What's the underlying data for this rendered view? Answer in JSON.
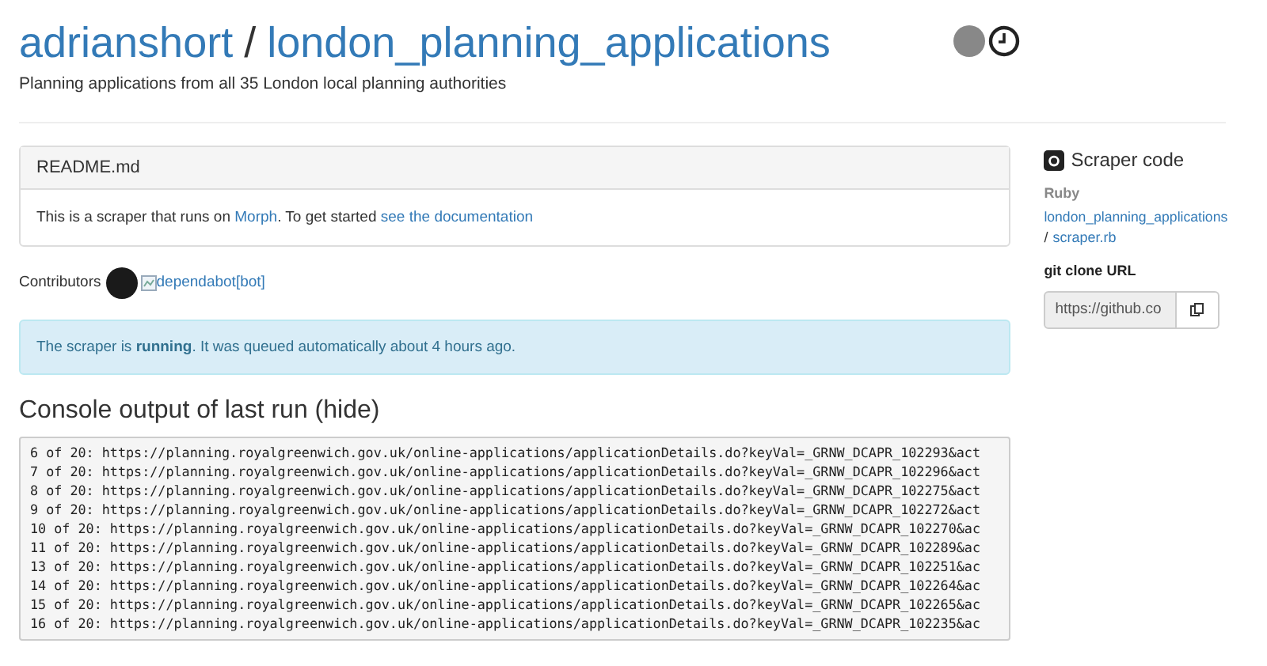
{
  "header": {
    "owner": "adrianshort",
    "separator": "/",
    "repo": "london_planning_applications",
    "description": "Planning applications from all 35 London local planning authorities"
  },
  "readme": {
    "title": "README.md",
    "text_before": "This is a scraper that runs on ",
    "link_1": "Morph",
    "text_mid": ". To get started ",
    "link_2": "see the documentation"
  },
  "contributors": {
    "label": "Contributors",
    "items": [
      {
        "kind": "avatar"
      },
      {
        "kind": "broken_image",
        "alt": "dependabot[bot]"
      }
    ]
  },
  "status": {
    "message": "The scraper is **running**. It was queued automatically about 4 hours ago."
  },
  "console": {
    "title": "Console output of last run (hide)",
    "lines": [
      "6 of 20: https://planning.royalgreenwich.gov.uk/online-applications/applicationDetails.do?keyVal=_GRNW_DCAPR_102293&act",
      "7 of 20: https://planning.royalgreenwich.gov.uk/online-applications/applicationDetails.do?keyVal=_GRNW_DCAPR_102296&act",
      "8 of 20: https://planning.royalgreenwich.gov.uk/online-applications/applicationDetails.do?keyVal=_GRNW_DCAPR_102275&act",
      "9 of 20: https://planning.royalgreenwich.gov.uk/online-applications/applicationDetails.do?keyVal=_GRNW_DCAPR_102272&act",
      "10 of 20: https://planning.royalgreenwich.gov.uk/online-applications/applicationDetails.do?keyVal=_GRNW_DCAPR_102270&ac",
      "11 of 20: https://planning.royalgreenwich.gov.uk/online-applications/applicationDetails.do?keyVal=_GRNW_DCAPR_102289&ac",
      "13 of 20: https://planning.royalgreenwich.gov.uk/online-applications/applicationDetails.do?keyVal=_GRNW_DCAPR_102251&ac",
      "14 of 20: https://planning.royalgreenwich.gov.uk/online-applications/applicationDetails.do?keyVal=_GRNW_DCAPR_102264&ac",
      "15 of 20: https://planning.royalgreenwich.gov.uk/online-applications/applicationDetails.do?keyVal=_GRNW_DCAPR_102265&ac",
      "16 of 20: https://planning.royalgreenwich.gov.uk/online-applications/applicationDetails.do?keyVal=_GRNW_DCAPR_102235&ac"
    ]
  },
  "sidebar": {
    "title": "Scraper code",
    "language": "Ruby",
    "repo_link": "london_planning_applications",
    "separator": "/",
    "file_link": "scraper.rb",
    "clone_label": "git clone URL",
    "clone_url": "https://github.co"
  }
}
